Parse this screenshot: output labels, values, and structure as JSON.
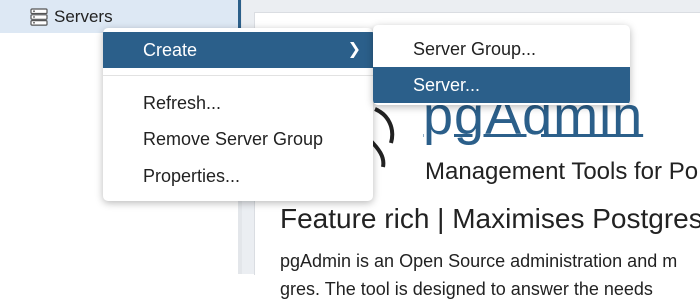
{
  "tree": {
    "servers_label": "Servers",
    "icon": "server-group-icon"
  },
  "dashboard": {
    "logo_text": "pgAdmin",
    "tagline": "Management Tools for Po",
    "feature_line": "Feature rich | Maximises Postgres",
    "description": "pgAdmin is an Open Source administration and m",
    "description_2": "gres. The tool is designed to answer the needs",
    "brand_color": "#2b5f8a"
  },
  "context_menu": {
    "create_label": "Create",
    "refresh_label": "Refresh...",
    "remove_label": "Remove Server Group",
    "properties_label": "Properties..."
  },
  "submenu": {
    "server_group_label": "Server Group...",
    "server_label": "Server..."
  },
  "colors": {
    "selection": "#dde8f4",
    "highlight": "#2b5f8a"
  }
}
